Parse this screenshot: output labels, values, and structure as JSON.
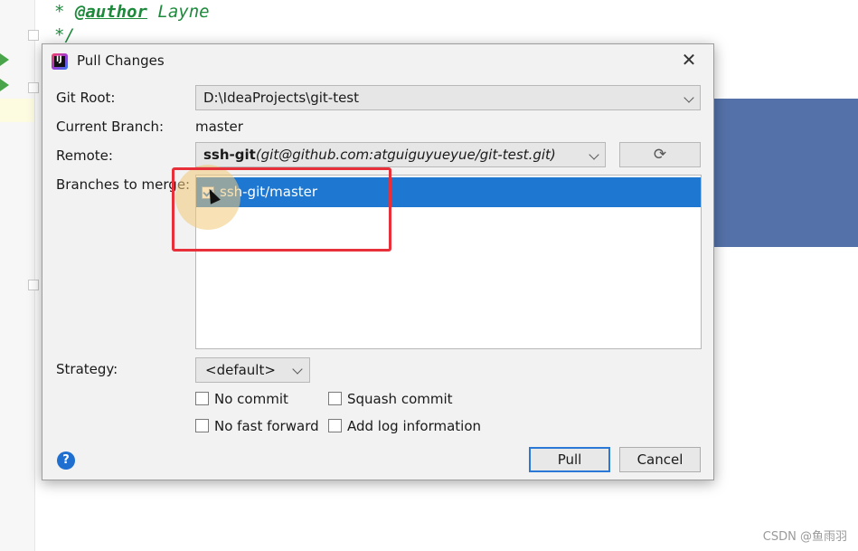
{
  "editor": {
    "code_line_1_prefix": "* ",
    "code_line_1_tag": "@author",
    "code_line_1_rest": " Layne",
    "code_line_2": "*/"
  },
  "dialog": {
    "title": "Pull Changes",
    "close_glyph": "✕",
    "app_icon_letters": "IJ",
    "git_root_label": "Git Root:",
    "git_root_value": "D:\\IdeaProjects\\git-test",
    "current_branch_label": "Current Branch:",
    "current_branch_value": "master",
    "remote_label": "Remote:",
    "remote_name": "ssh-git",
    "remote_url": "(git@github.com:atguiguyueyue/git-test.git)",
    "refresh_glyph": "⟳",
    "branches_label": "Branches to merge:",
    "branches": [
      {
        "name": "ssh-git/master",
        "checked": true,
        "selected": true
      }
    ],
    "strategy_label": "Strategy:",
    "strategy_value": "<default>",
    "options": {
      "no_commit": "No commit",
      "squash_commit": "Squash commit",
      "no_fast_forward": "No fast forward",
      "add_log_information": "Add log information"
    },
    "help_glyph": "?",
    "pull_button": "Pull",
    "cancel_button": "Cancel"
  },
  "watermark": "CSDN @鱼雨羽",
  "colors": {
    "selection": "#1e78d2",
    "highlight_frame": "#e8303a",
    "code_comment": "#1d8a3c"
  }
}
